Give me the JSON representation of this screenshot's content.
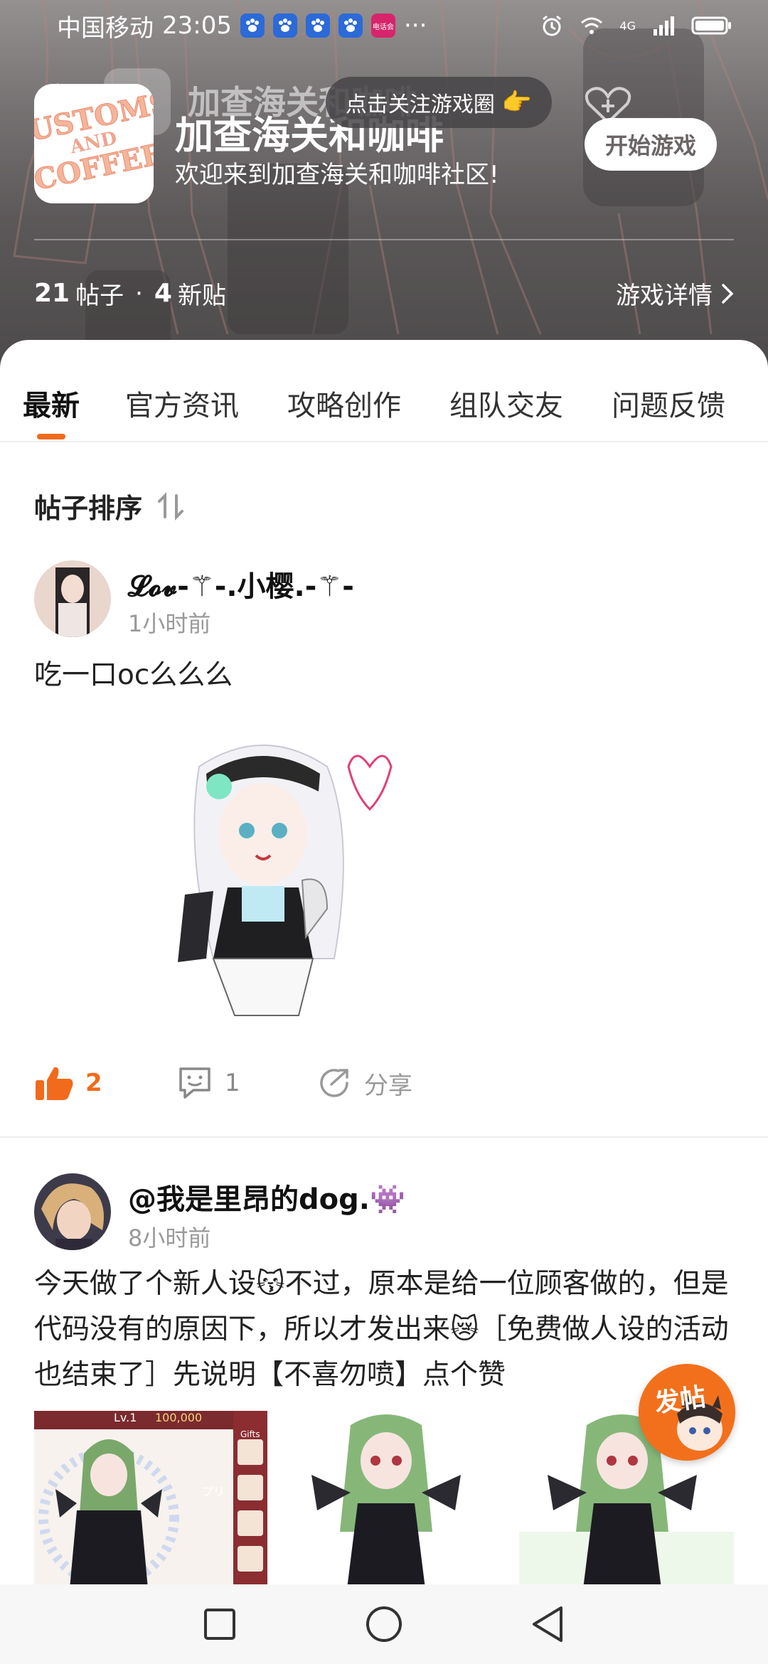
{
  "status_bar": {
    "carrier": "中国移动",
    "time": "23:05",
    "more": "···",
    "network": "4G",
    "mini_app_label": "电话会"
  },
  "header": {
    "title": "加查海关和咖啡",
    "welcome": "欢迎来到加查海关和咖啡社区!",
    "follow_prompt": "点击关注游戏圈",
    "play_button": "开始游戏",
    "logo_line1": "CUSTOMS",
    "logo_line2": "AND",
    "logo_line3": "COFFEE",
    "posts_count": "21",
    "posts_label": "帖子",
    "dot": "·",
    "new_count": "4",
    "new_label": "新贴",
    "details_link": "游戏详情"
  },
  "tabs": [
    {
      "label": "最新",
      "active": true
    },
    {
      "label": "官方资讯",
      "active": false
    },
    {
      "label": "攻略创作",
      "active": false
    },
    {
      "label": "组队交友",
      "active": false
    },
    {
      "label": "问题反馈",
      "active": false
    }
  ],
  "sort": {
    "label": "帖子排序"
  },
  "posts": [
    {
      "author": "𝓛𝓸𝓿-⚚-.小樱.-⚚-",
      "time": "1小时前",
      "text": "吃一口oc么么么",
      "likes": "2",
      "comments": "1",
      "share": "分享"
    },
    {
      "author": "@我是里昂的dog.👾",
      "time": "8小时前",
      "text": "今天做了个新人设😽不过，原本是给一位顾客做的，但是代码没有的原因下，所以才发出来😿［免费做人设的活动也结束了］先说明【不喜勿喷】点个赞"
    }
  ],
  "preview_game_ui": {
    "level": "Lv.1",
    "coins": "100,000",
    "gifts": "Gifts",
    "side_text": "プリ"
  },
  "fab": {
    "label": "发帖"
  },
  "colors": {
    "accent": "#f26a1b",
    "hero_dark": "#5a5657",
    "text_gray": "#999999"
  }
}
